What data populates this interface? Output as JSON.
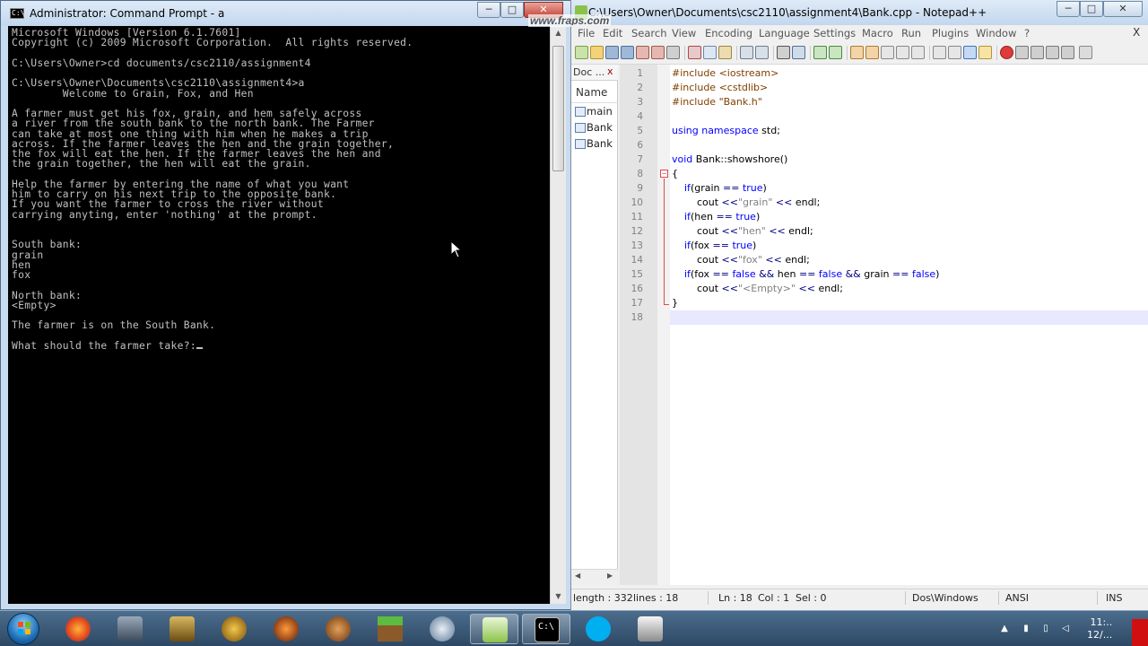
{
  "cmd": {
    "title": "Administrator: Command Prompt - a",
    "icon_text": "C:\\",
    "minimize": "─",
    "maximize": "□",
    "close": "✕",
    "lines": [
      "Microsoft Windows [Version 6.1.7601]",
      "Copyright (c) 2009 Microsoft Corporation.  All rights reserved.",
      "",
      "C:\\Users\\Owner>cd documents/csc2110/assignment4",
      "",
      "C:\\Users\\Owner\\Documents\\csc2110\\assignment4>a",
      "        Welcome to Grain, Fox, and Hen",
      "",
      "A farmer must get his fox, grain, and hem safely across",
      "a river from the south bank to the north bank. The Farmer",
      "can take at most one thing with him when he makes a trip",
      "across. If the farmer leaves the hen and the grain together,",
      "the fox will eat the hen. If the farmer leaves the hen and",
      "the grain together, the hen will eat the grain.",
      "",
      "Help the farmer by entering the name of what you want",
      "him to carry on his next trip to the opposite bank.",
      "If you want the farmer to cross the river without",
      "carrying anyting, enter 'nothing' at the prompt.",
      "",
      "",
      "South bank:",
      "grain",
      "hen",
      "fox",
      "",
      "North bank:",
      "<Empty>",
      "",
      "The farmer is on the South Bank.",
      "",
      "What should the farmer take?:"
    ]
  },
  "npp": {
    "title": "C:\\Users\\Owner\\Documents\\csc2110\\assignment4\\Bank.cpp - Notepad++",
    "watermark": "www.fraps.com",
    "menu": [
      "File",
      "Edit",
      "Search",
      "View",
      "Encoding",
      "Language",
      "Settings",
      "Macro",
      "Run",
      "Plugins",
      "Window",
      "?"
    ],
    "menu_close": "X",
    "doclist": {
      "tab": "Doc ...",
      "close": "x",
      "column": "Name",
      "items": [
        "main",
        "Bank",
        "Bank"
      ]
    },
    "code": [
      {
        "n": "1",
        "t": "#include <iostream>"
      },
      {
        "n": "2",
        "t": "#include <cstdlib>"
      },
      {
        "n": "3",
        "t": "#include \"Bank.h\""
      },
      {
        "n": "4",
        "t": ""
      },
      {
        "n": "5",
        "t": "using namespace std;"
      },
      {
        "n": "6",
        "t": ""
      },
      {
        "n": "7",
        "t": "void Bank::showshore()"
      },
      {
        "n": "8",
        "t": "{"
      },
      {
        "n": "9",
        "t": "    if(grain == true)"
      },
      {
        "n": "10",
        "t": "        cout <<\"grain\" << endl;"
      },
      {
        "n": "11",
        "t": "    if(hen == true)"
      },
      {
        "n": "12",
        "t": "        cout <<\"hen\" << endl;"
      },
      {
        "n": "13",
        "t": "    if(fox == true)"
      },
      {
        "n": "14",
        "t": "        cout <<\"fox\" << endl;"
      },
      {
        "n": "15",
        "t": "    if(fox == false && hen == false && grain == false)"
      },
      {
        "n": "16",
        "t": "        cout <<\"<Empty>\" << endl;"
      },
      {
        "n": "17",
        "t": "}"
      },
      {
        "n": "18",
        "t": ""
      }
    ],
    "status": {
      "length": "length : 332",
      "lines": "lines : 18",
      "ln": "Ln : 18",
      "col": "Col : 1",
      "sel": "Sel : 0",
      "eol": "Dos\\Windows",
      "encoding": "ANSI",
      "mode": "INS"
    }
  },
  "taskbar": {
    "apps": [
      "windows-explorer",
      "firefox",
      "starcraft",
      "league-of-legends",
      "world-of-warcraft",
      "diablo",
      "old-republic",
      "minecraft",
      "voice-chat",
      "notepad-plus-plus",
      "command-prompt",
      "skype",
      "fraps"
    ],
    "tray": {
      "clock_time": "11:..",
      "clock_date": "12/..."
    }
  }
}
